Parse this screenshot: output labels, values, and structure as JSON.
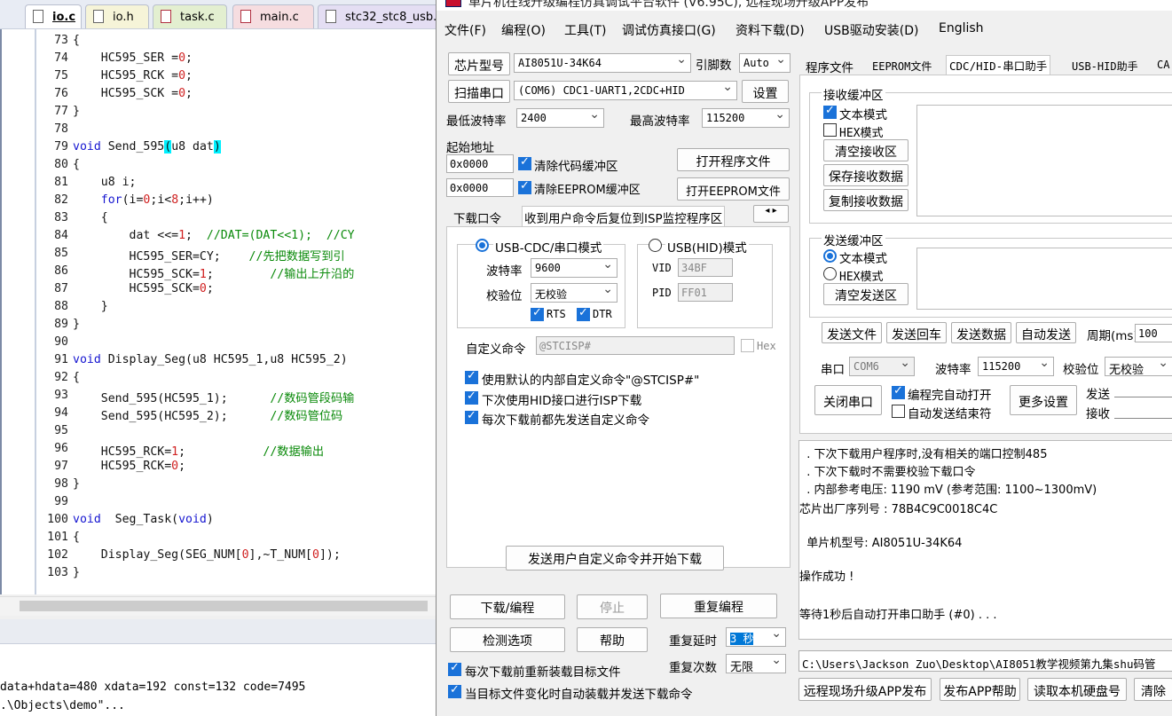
{
  "editor": {
    "tabs": [
      "io.c",
      "io.h",
      "task.c",
      "main.c",
      "stc32_stc8_usb."
    ],
    "lines": [
      {
        "n": "73",
        "t": "{"
      },
      {
        "n": "74",
        "t": "    HC595_SER =0;"
      },
      {
        "n": "75",
        "t": "    HC595_RCK =0;"
      },
      {
        "n": "76",
        "t": "    HC595_SCK =0;"
      },
      {
        "n": "77",
        "t": "}"
      },
      {
        "n": "78",
        "t": ""
      },
      {
        "n": "79",
        "t": "void Send_595(u8 dat)"
      },
      {
        "n": "80",
        "t": "{"
      },
      {
        "n": "81",
        "t": "    u8 i;"
      },
      {
        "n": "82",
        "t": "    for(i=0;i<8;i++)"
      },
      {
        "n": "83",
        "t": "    {"
      },
      {
        "n": "84",
        "t": "        dat <<=1;  //DAT=(DAT<<1);  //CY"
      },
      {
        "n": "85",
        "t": "        HC595_SER=CY;    //先把数据写到引"
      },
      {
        "n": "86",
        "t": "        HC595_SCK=1;        //输出上升沿的"
      },
      {
        "n": "87",
        "t": "        HC595_SCK=0;"
      },
      {
        "n": "88",
        "t": "    }"
      },
      {
        "n": "89",
        "t": "}"
      },
      {
        "n": "90",
        "t": ""
      },
      {
        "n": "91",
        "t": "void Display_Seg(u8 HC595_1,u8 HC595_2)"
      },
      {
        "n": "92",
        "t": "{"
      },
      {
        "n": "93",
        "t": "    Send_595(HC595_1);      //数码管段码输"
      },
      {
        "n": "94",
        "t": "    Send_595(HC595_2);      //数码管位码"
      },
      {
        "n": "95",
        "t": ""
      },
      {
        "n": "96",
        "t": "    HC595_RCK=1;           //数据输出"
      },
      {
        "n": "97",
        "t": "    HC595_RCK=0;"
      },
      {
        "n": "98",
        "t": "}"
      },
      {
        "n": "99",
        "t": ""
      },
      {
        "n": "100",
        "t": "void  Seg_Task(void)"
      },
      {
        "n": "101",
        "t": "{"
      },
      {
        "n": "102",
        "t": "    Display_Seg(SEG_NUM[0],~T_NUM[0]);"
      },
      {
        "n": "103",
        "t": "}"
      }
    ],
    "build_lines": [
      "data+hdata=480 xdata=192 const=132 code=7495",
      ".\\Objects\\demo\"..."
    ]
  },
  "app": {
    "title": "单片机在线升级编程仿真调试平台软件 (V6.95C), 远程现场升级APP发布",
    "menus": [
      "文件(F)",
      "编程(O)",
      "工具(T)",
      "调试仿真接口(G)",
      "资料下载(D)",
      "USB驱动安装(D)",
      "English"
    ],
    "left": {
      "chip_btn": "芯片型号",
      "chip_value": "AI8051U-34K64",
      "pins_label": "引脚数",
      "pins_value": "Auto",
      "scan_btn": "扫描串口",
      "port_value": "(COM6) CDC1-UART1,2CDC+HID",
      "settings_btn": "设置",
      "min_baud_label": "最低波特率",
      "min_baud": "2400",
      "max_baud_label": "最高波特率",
      "max_baud": "115200",
      "start_addr_label": "起始地址",
      "addr1": "0x0000",
      "clear_code": "清除代码缓冲区",
      "open_prog": "打开程序文件",
      "addr2": "0x0000",
      "clear_eeprom": "清除EEPROM缓冲区",
      "open_eeprom": "打开EEPROM文件",
      "tab_download": "下载口令",
      "tab_reset": "收到用户命令后复位到ISP监控程序区",
      "usb_cdc_mode": "USB-CDC/串口模式",
      "baud_label": "波特率",
      "baud_value": "9600",
      "parity_label": "校验位",
      "parity_value": "无校验",
      "rts": "RTS",
      "dtr": "DTR",
      "usb_hid_mode": "USB(HID)模式",
      "vid_label": "VID",
      "vid_value": "34BF",
      "pid_label": "PID",
      "pid_value": "FF01",
      "custom_cmd_label": "自定义命令",
      "custom_cmd_value": "@STCISP#",
      "hex_label": "Hex",
      "opt1": "使用默认的内部自定义命令\"@STCISP#\"",
      "opt2": "下次使用HID接口进行ISP下载",
      "opt3": "每次下载前都先发送自定义命令",
      "send_cmd_btn": "发送用户自定义命令并开始下载",
      "download_btn": "下载/编程",
      "stop_btn": "停止",
      "reprogram_btn": "重复编程",
      "check_btn": "检测选项",
      "help_btn": "帮助",
      "repeat_delay_label": "重复延时",
      "repeat_delay_value": "3 秒",
      "repeat_count_label": "重复次数",
      "repeat_count_value": "无限",
      "reload_opt": "每次下载前重新装载目标文件",
      "auto_reload_opt": "当目标文件变化时自动装载并发送下载命令"
    },
    "right": {
      "tabs": [
        "程序文件",
        "EEPROM文件",
        "CDC/HID-串口助手",
        "USB-HID助手",
        "CA"
      ],
      "recv_group": "接收缓冲区",
      "recv_text_mode": "文本模式",
      "recv_hex_mode": "HEX模式",
      "clear_recv": "清空接收区",
      "save_recv": "保存接收数据",
      "copy_recv": "复制接收数据",
      "send_group": "发送缓冲区",
      "send_text_mode": "文本模式",
      "send_hex_mode": "HEX模式",
      "clear_send": "清空发送区",
      "send_file": "发送文件",
      "send_return": "发送回车",
      "send_data": "发送数据",
      "auto_send": "自动发送",
      "period_label": "周期(ms)",
      "period_value": "100",
      "port_label": "串口",
      "port_value": "COM6",
      "baud_label": "波特率",
      "baud_value": "115200",
      "parity_label": "校验位",
      "parity_value": "无校验",
      "close_port": "关闭串口",
      "auto_open": "编程完自动打开",
      "auto_send_end": "自动发送结束符",
      "more_settings": "更多设置",
      "send_count_label": "发送",
      "recv_count_label": "接收"
    },
    "log": [
      "  . 下次下载用户程序时,没有相关的端口控制485",
      "  . 下次下载时不需要校验下载口令",
      "  . 内部参考电压: 1190 mV (参考范围: 1100~1300mV)",
      "芯片出厂序列号 : 78B4C9C0018C4C",
      "",
      "  单片机型号: AI8051U-34K64",
      "",
      "操作成功 !",
      "",
      "等待1秒后自动打开串口助手 (#0) . . ."
    ],
    "path": "C:\\Users\\Jackson Zuo\\Desktop\\AI8051教学视频第九集shu码管",
    "bottom_btns": [
      "远程现场升级APP发布",
      "发布APP帮助",
      "读取本机硬盘号",
      "清除"
    ]
  }
}
